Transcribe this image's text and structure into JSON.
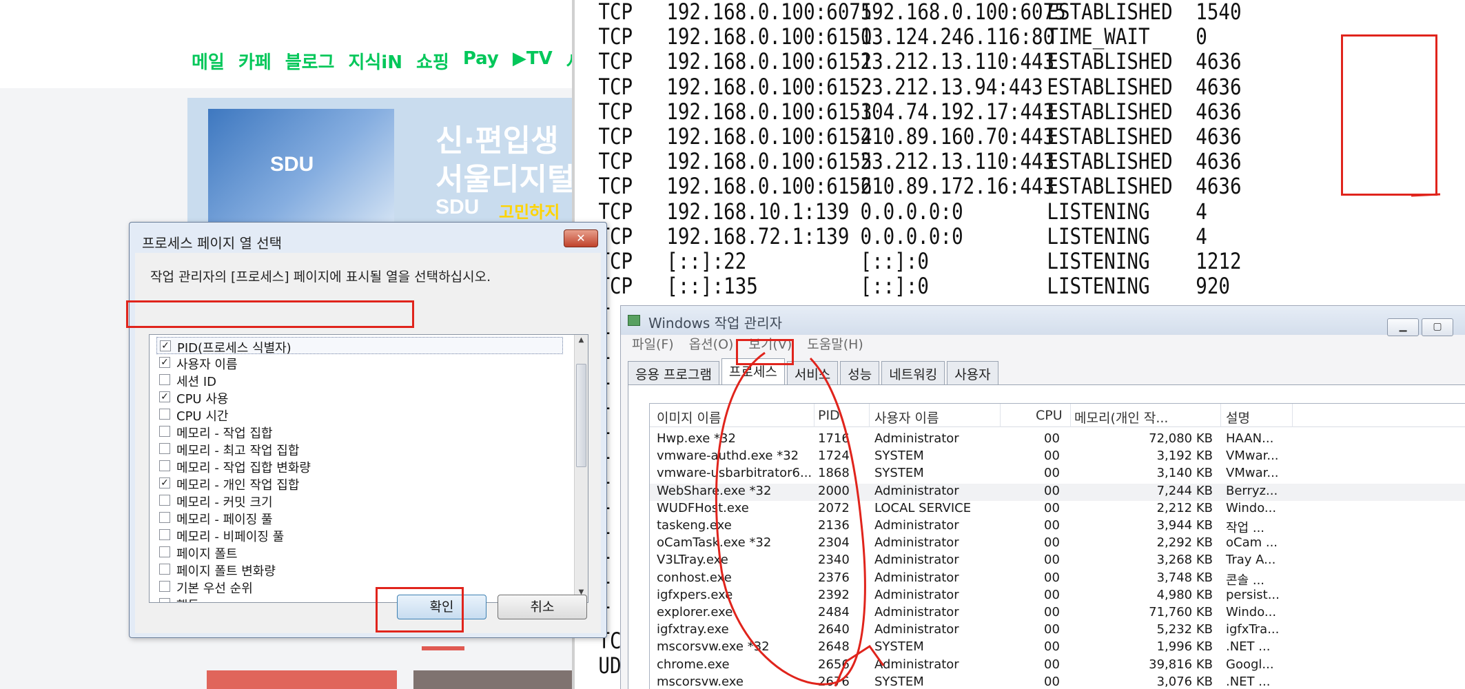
{
  "browser": {
    "nav": [
      "메일",
      "카페",
      "블로그",
      "지식iN",
      "쇼핑",
      "Pay",
      "▶TV",
      "사"
    ],
    "ad": {
      "logo": "SDU",
      "headline_1": "신·편입생 !",
      "headline_2": "서울디지털",
      "logo_2": "SDU",
      "tag": "고민하지"
    }
  },
  "console": {
    "rows": [
      {
        "proto": "TCP",
        "local": "192.168.0.100:6075",
        "foreign": "192.168.0.100:6075",
        "state": "ESTABLISHED",
        "pid": "1540"
      },
      {
        "proto": "TCP",
        "local": "192.168.0.100:6150",
        "foreign": "13.124.246.116:80",
        "state": "TIME_WAIT",
        "pid": "0"
      },
      {
        "proto": "TCP",
        "local": "192.168.0.100:6151",
        "foreign": "23.212.13.110:443",
        "state": "ESTABLISHED",
        "pid": "4636"
      },
      {
        "proto": "TCP",
        "local": "192.168.0.100:6152",
        "foreign": "23.212.13.94:443",
        "state": "ESTABLISHED",
        "pid": "4636"
      },
      {
        "proto": "TCP",
        "local": "192.168.0.100:6153",
        "foreign": "104.74.192.17:443",
        "state": "ESTABLISHED",
        "pid": "4636"
      },
      {
        "proto": "TCP",
        "local": "192.168.0.100:6154",
        "foreign": "210.89.160.70:443",
        "state": "ESTABLISHED",
        "pid": "4636"
      },
      {
        "proto": "TCP",
        "local": "192.168.0.100:6155",
        "foreign": "23.212.13.110:443",
        "state": "ESTABLISHED",
        "pid": "4636"
      },
      {
        "proto": "TCP",
        "local": "192.168.0.100:6156",
        "foreign": "210.89.172.16:443",
        "state": "ESTABLISHED",
        "pid": "4636"
      },
      {
        "proto": "TCP",
        "local": "192.168.10.1:139",
        "foreign": "0.0.0.0:0",
        "state": "LISTENING",
        "pid": "4"
      },
      {
        "proto": "TCP",
        "local": "192.168.72.1:139",
        "foreign": "0.0.0.0:0",
        "state": "LISTENING",
        "pid": "4"
      },
      {
        "proto": "TCP",
        "local": "[::]:22",
        "foreign": "[::]:0",
        "state": "LISTENING",
        "pid": "1212"
      },
      {
        "proto": "TCP",
        "local": "[::]:135",
        "foreign": "[::]:0",
        "state": "LISTENING",
        "pid": "920"
      }
    ],
    "bottom_fragments": [
      "T",
      "T",
      "T",
      "T",
      "T",
      "T",
      "T",
      "T",
      "T",
      "T",
      "T",
      "T",
      "T",
      "TC",
      "UD"
    ]
  },
  "taskmgr": {
    "title": "Windows 작업 관리자",
    "menu": [
      "파일(F)",
      "옵션(O)",
      "보기(V)",
      "도움말(H)"
    ],
    "tabs": [
      "응용 프로그램",
      "프로세스",
      "서비스",
      "성능",
      "네트워킹",
      "사용자"
    ],
    "columns": [
      "이미지 이름",
      "PID",
      "사용자 이름",
      "CPU",
      "메모리(개인 작...",
      "설명"
    ],
    "processes": [
      {
        "name": "Hwp.exe *32",
        "pid": "1716",
        "user": "Administrator",
        "cpu": "00",
        "mem": "72,080 KB",
        "desc": "HAAN..."
      },
      {
        "name": "vmware-authd.exe *32",
        "pid": "1724",
        "user": "SYSTEM",
        "cpu": "00",
        "mem": "3,192 KB",
        "desc": "VMwar..."
      },
      {
        "name": "vmware-usbarbitrator6...",
        "pid": "1868",
        "user": "SYSTEM",
        "cpu": "00",
        "mem": "3,140 KB",
        "desc": "VMwar..."
      },
      {
        "name": "WebShare.exe *32",
        "pid": "2000",
        "user": "Administrator",
        "cpu": "00",
        "mem": "7,244 KB",
        "desc": "Berryz..."
      },
      {
        "name": "WUDFHost.exe",
        "pid": "2072",
        "user": "LOCAL SERVICE",
        "cpu": "00",
        "mem": "2,212 KB",
        "desc": "Windo..."
      },
      {
        "name": "taskeng.exe",
        "pid": "2136",
        "user": "Administrator",
        "cpu": "00",
        "mem": "3,944 KB",
        "desc": "작업 ..."
      },
      {
        "name": "oCamTask.exe *32",
        "pid": "2304",
        "user": "Administrator",
        "cpu": "00",
        "mem": "2,292 KB",
        "desc": "oCam ..."
      },
      {
        "name": "V3LTray.exe",
        "pid": "2340",
        "user": "Administrator",
        "cpu": "00",
        "mem": "3,268 KB",
        "desc": "Tray A..."
      },
      {
        "name": "conhost.exe",
        "pid": "2376",
        "user": "Administrator",
        "cpu": "00",
        "mem": "3,748 KB",
        "desc": "콘솔 ..."
      },
      {
        "name": "igfxpers.exe",
        "pid": "2392",
        "user": "Administrator",
        "cpu": "00",
        "mem": "4,980 KB",
        "desc": "persist..."
      },
      {
        "name": "explorer.exe",
        "pid": "2484",
        "user": "Administrator",
        "cpu": "00",
        "mem": "71,760 KB",
        "desc": "Windo..."
      },
      {
        "name": "igfxtray.exe",
        "pid": "2640",
        "user": "Administrator",
        "cpu": "00",
        "mem": "5,232 KB",
        "desc": "igfxTra..."
      },
      {
        "name": "mscorsvw.exe *32",
        "pid": "2648",
        "user": "SYSTEM",
        "cpu": "00",
        "mem": "1,996 KB",
        "desc": ".NET ..."
      },
      {
        "name": "chrome.exe",
        "pid": "2656",
        "user": "Administrator",
        "cpu": "00",
        "mem": "39,816 KB",
        "desc": "Googl..."
      },
      {
        "name": "mscorsvw.exe",
        "pid": "2676",
        "user": "SYSTEM",
        "cpu": "00",
        "mem": "3,076 KB",
        "desc": ".NET ..."
      }
    ]
  },
  "dialog": {
    "title": "프로세스 페이지 열 선택",
    "close": "✕",
    "description": "작업 관리자의 [프로세스] 페이지에 표시될 열을 선택하십시오.",
    "items": [
      {
        "label": "PID(프로세스 식별자)",
        "checked": true
      },
      {
        "label": "사용자 이름",
        "checked": true
      },
      {
        "label": "세션 ID",
        "checked": false
      },
      {
        "label": "CPU 사용",
        "checked": true
      },
      {
        "label": "CPU 시간",
        "checked": false
      },
      {
        "label": "메모리 - 작업 집합",
        "checked": false
      },
      {
        "label": "메모리 - 최고 작업 집합",
        "checked": false
      },
      {
        "label": "메모리 - 작업 집합 변화량",
        "checked": false
      },
      {
        "label": "메모리 - 개인 작업 집합",
        "checked": true
      },
      {
        "label": "메모리 - 커밋 크기",
        "checked": false
      },
      {
        "label": "메모리 - 페이징 풀",
        "checked": false
      },
      {
        "label": "메모리 - 비페이징 풀",
        "checked": false
      },
      {
        "label": "페이지 폴트",
        "checked": false
      },
      {
        "label": "페이지 폴트 변화량",
        "checked": false
      },
      {
        "label": "기본 우선 순위",
        "checked": false
      },
      {
        "label": "핸들",
        "checked": false
      }
    ],
    "ok": "확인",
    "cancel": "취소"
  },
  "colors": {
    "annotation": "#e0241c",
    "naver_green": "#03c75a"
  }
}
